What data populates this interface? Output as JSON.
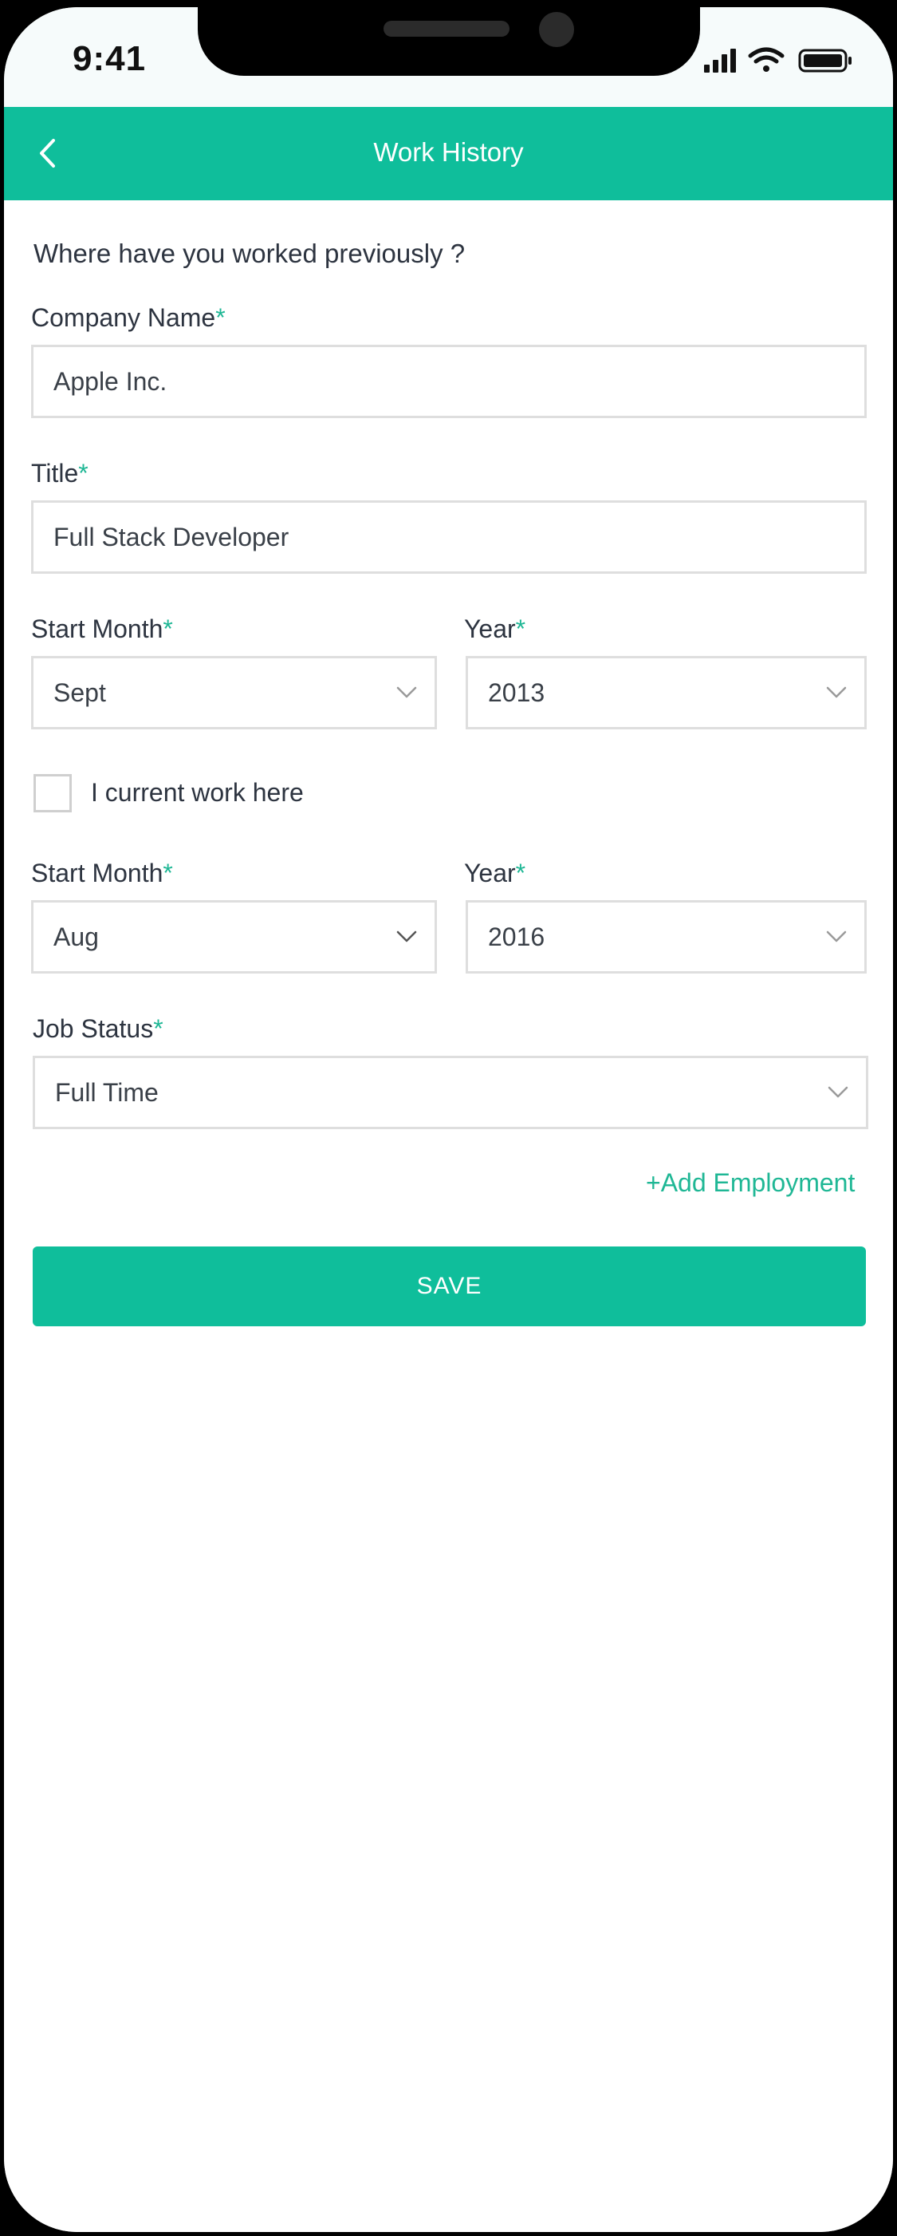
{
  "status_bar": {
    "time": "9:41",
    "icons": [
      "signal-icon",
      "wifi-icon",
      "battery-icon"
    ]
  },
  "header": {
    "title": "Work History",
    "back_icon": "chevron-left-icon"
  },
  "form": {
    "question": "Where have you worked previously ?",
    "required_marker": "*",
    "company": {
      "label": "Company Name",
      "value": "Apple Inc."
    },
    "title": {
      "label": "Title",
      "value": "Full Stack Developer"
    },
    "start": {
      "month_label": "Start Month",
      "month_value": "Sept",
      "year_label": "Year",
      "year_value": "2013"
    },
    "current_work": {
      "label": "I current work here",
      "checked": false
    },
    "end": {
      "month_label": "Start Month",
      "month_value": "Aug",
      "year_label": "Year",
      "year_value": "2016"
    },
    "job_status": {
      "label": "Job Status",
      "value": "Full Time"
    },
    "add_employment": "+Add Employment",
    "save": "SAVE"
  },
  "colors": {
    "accent": "#0fbe9b",
    "required": "#1fb795",
    "text": "#2d3440",
    "border": "#dedede"
  }
}
